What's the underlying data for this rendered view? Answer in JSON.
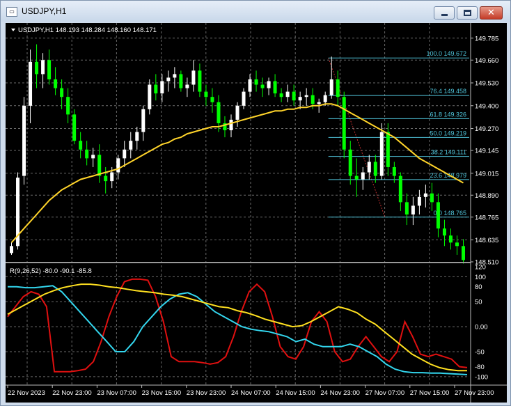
{
  "window": {
    "title": "USDJPY,H1",
    "icon": "chart-window-icon",
    "buttons": [
      "minimize-icon",
      "maximize-icon",
      "close-icon"
    ]
  },
  "price_panel": {
    "header": "USDJPY,H1  148.193 148.284 148.160 148.171",
    "price_labels": [
      "149.785",
      "149.660",
      "149.530",
      "149.400",
      "149.270",
      "149.145",
      "149.015",
      "148.890",
      "148.765",
      "148.635",
      "148.510"
    ],
    "fib_labels": [
      "100.0  149.672",
      "76.4  149.458",
      "61.8  149.326",
      "50.0  149.219",
      "38.2  149.111",
      "23.6  148.979",
      "0.0  148.765"
    ]
  },
  "indicator_panel": {
    "header": "R(9,26,52) -80.0 -90.1 -85.8",
    "scale_labels": [
      "120",
      "100",
      "80",
      "50",
      "0.00",
      "-50",
      "-80",
      "-100"
    ]
  },
  "time_axis": {
    "labels": [
      "22 Nov 2023",
      "22 Nov 23:00",
      "23 Nov 07:00",
      "23 Nov 15:00",
      "23 Nov 23:00",
      "24 Nov 07:00",
      "24 Nov 15:00",
      "24 Nov 23:00",
      "27 Nov 07:00",
      "27 Nov 15:00",
      "27 Nov 23:00"
    ]
  },
  "colors": {
    "background": "#000000",
    "bull": "#ffffff",
    "bear": "#00ff00",
    "ma": "#ffd42a",
    "fib": "#4fc3d9",
    "osc_fast": "#e01010",
    "osc_mid": "#33d6ee",
    "osc_slow": "#ffe020",
    "grid": "#6a6a6a"
  },
  "chart_data": {
    "type": "candlestick",
    "ylim": [
      148.51,
      149.8
    ],
    "indicator_ylim": [
      -110,
      120
    ],
    "fib_levels": [
      149.672,
      149.458,
      149.326,
      149.219,
      149.111,
      148.979,
      148.765
    ],
    "bars": [
      [
        148.56,
        148.62,
        148.55,
        148.6
      ],
      [
        148.6,
        149.02,
        148.58,
        148.99
      ],
      [
        149.0,
        149.45,
        148.95,
        149.4
      ],
      [
        149.4,
        149.72,
        149.3,
        149.65
      ],
      [
        149.65,
        149.75,
        149.5,
        149.58
      ],
      [
        149.58,
        149.7,
        149.5,
        149.66
      ],
      [
        149.66,
        149.72,
        149.52,
        149.55
      ],
      [
        149.55,
        149.62,
        149.46,
        149.5
      ],
      [
        149.5,
        149.55,
        149.38,
        149.45
      ],
      [
        149.45,
        149.5,
        149.3,
        149.35
      ],
      [
        149.35,
        149.38,
        149.18,
        149.2
      ],
      [
        149.2,
        149.25,
        149.1,
        149.15
      ],
      [
        149.15,
        149.2,
        149.06,
        149.1
      ],
      [
        149.1,
        149.16,
        149.05,
        149.12
      ],
      [
        149.12,
        149.18,
        148.96,
        149.0
      ],
      [
        149.0,
        149.05,
        148.9,
        148.97
      ],
      [
        148.97,
        149.05,
        148.93,
        149.02
      ],
      [
        149.02,
        149.12,
        148.98,
        149.1
      ],
      [
        149.1,
        149.2,
        149.05,
        149.15
      ],
      [
        149.15,
        149.25,
        149.1,
        149.2
      ],
      [
        149.2,
        149.28,
        149.15,
        149.25
      ],
      [
        149.25,
        149.4,
        149.2,
        149.38
      ],
      [
        149.38,
        149.55,
        149.35,
        149.52
      ],
      [
        149.52,
        149.58,
        149.43,
        149.47
      ],
      [
        149.47,
        149.58,
        149.42,
        149.54
      ],
      [
        149.54,
        149.6,
        149.48,
        149.56
      ],
      [
        149.56,
        149.62,
        149.5,
        149.58
      ],
      [
        149.58,
        149.6,
        149.48,
        149.5
      ],
      [
        149.5,
        149.56,
        149.45,
        149.52
      ],
      [
        149.52,
        149.66,
        149.48,
        149.6
      ],
      [
        149.6,
        149.64,
        149.45,
        149.48
      ],
      [
        149.48,
        149.52,
        149.4,
        149.45
      ],
      [
        149.45,
        149.5,
        149.36,
        149.42
      ],
      [
        149.42,
        149.46,
        149.25,
        149.3
      ],
      [
        149.3,
        149.34,
        149.22,
        149.26
      ],
      [
        149.26,
        149.35,
        149.22,
        149.32
      ],
      [
        149.32,
        149.42,
        149.28,
        149.4
      ],
      [
        149.4,
        149.5,
        149.38,
        149.48
      ],
      [
        149.48,
        149.58,
        149.45,
        149.55
      ],
      [
        149.55,
        149.6,
        149.48,
        149.52
      ],
      [
        149.52,
        149.56,
        149.45,
        149.5
      ],
      [
        149.5,
        149.56,
        149.46,
        149.54
      ],
      [
        149.54,
        149.58,
        149.45,
        149.47
      ],
      [
        149.47,
        149.5,
        149.42,
        149.45
      ],
      [
        149.45,
        149.52,
        149.42,
        149.48
      ],
      [
        149.48,
        149.52,
        149.4,
        149.43
      ],
      [
        149.43,
        149.48,
        149.38,
        149.45
      ],
      [
        149.45,
        149.5,
        149.4,
        149.46
      ],
      [
        149.46,
        149.5,
        149.38,
        149.41
      ],
      [
        149.41,
        149.44,
        149.36,
        149.42
      ],
      [
        149.42,
        149.48,
        149.4,
        149.46
      ],
      [
        149.46,
        149.68,
        149.44,
        149.55
      ],
      [
        149.55,
        149.6,
        149.4,
        149.45
      ],
      [
        149.45,
        149.48,
        149.1,
        149.15
      ],
      [
        149.15,
        149.2,
        148.95,
        149.0
      ],
      [
        149.0,
        149.1,
        148.88,
        148.98
      ],
      [
        148.98,
        149.05,
        148.92,
        149.02
      ],
      [
        149.02,
        149.12,
        148.98,
        149.08
      ],
      [
        149.08,
        149.12,
        148.96,
        149.0
      ],
      [
        149.0,
        149.3,
        148.98,
        149.25
      ],
      [
        149.25,
        149.3,
        149.0,
        149.05
      ],
      [
        149.05,
        149.08,
        148.96,
        149.0
      ],
      [
        149.0,
        149.02,
        148.8,
        148.85
      ],
      [
        148.85,
        148.9,
        148.72,
        148.78
      ],
      [
        148.78,
        148.88,
        148.72,
        148.83
      ],
      [
        148.83,
        148.92,
        148.78,
        148.88
      ],
      [
        148.88,
        148.95,
        148.82,
        148.9
      ],
      [
        148.9,
        148.96,
        148.8,
        148.85
      ],
      [
        148.85,
        148.9,
        148.65,
        148.7
      ],
      [
        148.7,
        148.75,
        148.6,
        148.66
      ],
      [
        148.66,
        148.7,
        148.58,
        148.62
      ],
      [
        148.62,
        148.66,
        148.55,
        148.6
      ],
      [
        148.6,
        148.64,
        148.5,
        148.52
      ]
    ],
    "ma": [
      148.62,
      148.66,
      148.7,
      148.74,
      148.78,
      148.82,
      148.86,
      148.89,
      148.92,
      148.94,
      148.96,
      148.98,
      148.99,
      149.0,
      149.01,
      149.02,
      149.03,
      149.04,
      149.06,
      149.08,
      149.1,
      149.12,
      149.14,
      149.16,
      149.18,
      149.19,
      149.21,
      149.22,
      149.24,
      149.25,
      149.26,
      149.27,
      149.28,
      149.28,
      149.29,
      149.3,
      149.31,
      149.32,
      149.33,
      149.34,
      149.35,
      149.36,
      149.37,
      149.37,
      149.38,
      149.38,
      149.39,
      149.39,
      149.4,
      149.4,
      149.41,
      149.41,
      149.4,
      149.38,
      149.36,
      149.34,
      149.32,
      149.3,
      149.28,
      149.26,
      149.24,
      149.22,
      149.19,
      149.16,
      149.13,
      149.1,
      149.08,
      149.06,
      149.04,
      149.02,
      149.0,
      148.98,
      148.96
    ],
    "osc_fast": [
      20,
      40,
      60,
      70,
      65,
      40,
      -90,
      -90,
      -90,
      -88,
      -85,
      -70,
      -30,
      20,
      60,
      90,
      95,
      95,
      93,
      60,
      10,
      -60,
      -70,
      -70,
      -70,
      -72,
      -75,
      -72,
      -60,
      -20,
      30,
      70,
      85,
      70,
      20,
      -40,
      -60,
      -65,
      -40,
      10,
      30,
      10,
      -50,
      -70,
      -65,
      -40,
      -20,
      -40,
      -60,
      -70,
      -50,
      10,
      -20,
      -55,
      -60,
      -55,
      -60,
      -65,
      -80,
      -82
    ],
    "osc_mid": [
      80,
      80,
      78,
      78,
      80,
      82,
      70,
      50,
      30,
      10,
      -10,
      -30,
      -50,
      -50,
      -30,
      0,
      20,
      40,
      55,
      65,
      68,
      60,
      45,
      30,
      20,
      10,
      0,
      -5,
      -8,
      -10,
      -15,
      -20,
      -30,
      -25,
      -35,
      -40,
      -40,
      -40,
      -35,
      -40,
      -50,
      -60,
      -75,
      -85,
      -90,
      -92,
      -92,
      -93,
      -93,
      -94,
      -95,
      -96
    ],
    "osc_slow": [
      25,
      35,
      45,
      55,
      65,
      72,
      78,
      82,
      85,
      85,
      83,
      80,
      78,
      75,
      72,
      70,
      68,
      65,
      63,
      60,
      55,
      50,
      45,
      40,
      38,
      32,
      28,
      22,
      15,
      10,
      5,
      0,
      2,
      10,
      20,
      30,
      40,
      35,
      28,
      15,
      5,
      -10,
      -25,
      -40,
      -55,
      -65,
      -75,
      -82,
      -86,
      -88,
      -88
    ]
  }
}
